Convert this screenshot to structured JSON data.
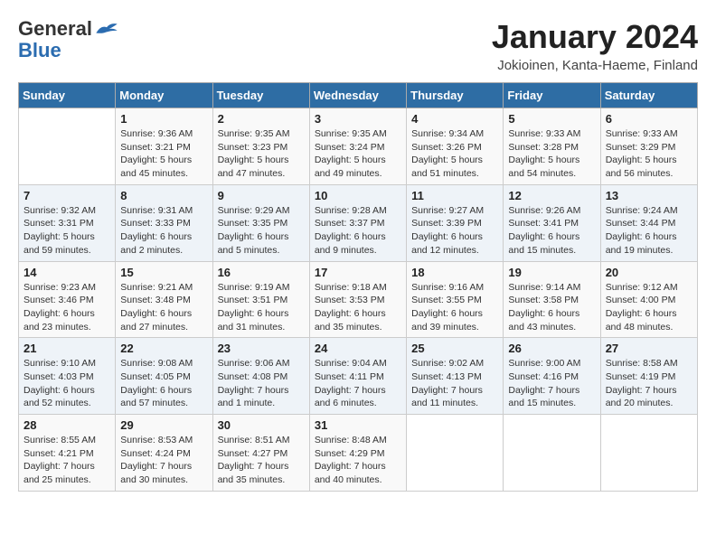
{
  "header": {
    "logo_general": "General",
    "logo_blue": "Blue",
    "month_title": "January 2024",
    "subtitle": "Jokioinen, Kanta-Haeme, Finland"
  },
  "days_of_week": [
    "Sunday",
    "Monday",
    "Tuesday",
    "Wednesday",
    "Thursday",
    "Friday",
    "Saturday"
  ],
  "weeks": [
    [
      {
        "day": "",
        "info": ""
      },
      {
        "day": "1",
        "info": "Sunrise: 9:36 AM\nSunset: 3:21 PM\nDaylight: 5 hours\nand 45 minutes."
      },
      {
        "day": "2",
        "info": "Sunrise: 9:35 AM\nSunset: 3:23 PM\nDaylight: 5 hours\nand 47 minutes."
      },
      {
        "day": "3",
        "info": "Sunrise: 9:35 AM\nSunset: 3:24 PM\nDaylight: 5 hours\nand 49 minutes."
      },
      {
        "day": "4",
        "info": "Sunrise: 9:34 AM\nSunset: 3:26 PM\nDaylight: 5 hours\nand 51 minutes."
      },
      {
        "day": "5",
        "info": "Sunrise: 9:33 AM\nSunset: 3:28 PM\nDaylight: 5 hours\nand 54 minutes."
      },
      {
        "day": "6",
        "info": "Sunrise: 9:33 AM\nSunset: 3:29 PM\nDaylight: 5 hours\nand 56 minutes."
      }
    ],
    [
      {
        "day": "7",
        "info": "Sunrise: 9:32 AM\nSunset: 3:31 PM\nDaylight: 5 hours\nand 59 minutes."
      },
      {
        "day": "8",
        "info": "Sunrise: 9:31 AM\nSunset: 3:33 PM\nDaylight: 6 hours\nand 2 minutes."
      },
      {
        "day": "9",
        "info": "Sunrise: 9:29 AM\nSunset: 3:35 PM\nDaylight: 6 hours\nand 5 minutes."
      },
      {
        "day": "10",
        "info": "Sunrise: 9:28 AM\nSunset: 3:37 PM\nDaylight: 6 hours\nand 9 minutes."
      },
      {
        "day": "11",
        "info": "Sunrise: 9:27 AM\nSunset: 3:39 PM\nDaylight: 6 hours\nand 12 minutes."
      },
      {
        "day": "12",
        "info": "Sunrise: 9:26 AM\nSunset: 3:41 PM\nDaylight: 6 hours\nand 15 minutes."
      },
      {
        "day": "13",
        "info": "Sunrise: 9:24 AM\nSunset: 3:44 PM\nDaylight: 6 hours\nand 19 minutes."
      }
    ],
    [
      {
        "day": "14",
        "info": "Sunrise: 9:23 AM\nSunset: 3:46 PM\nDaylight: 6 hours\nand 23 minutes."
      },
      {
        "day": "15",
        "info": "Sunrise: 9:21 AM\nSunset: 3:48 PM\nDaylight: 6 hours\nand 27 minutes."
      },
      {
        "day": "16",
        "info": "Sunrise: 9:19 AM\nSunset: 3:51 PM\nDaylight: 6 hours\nand 31 minutes."
      },
      {
        "day": "17",
        "info": "Sunrise: 9:18 AM\nSunset: 3:53 PM\nDaylight: 6 hours\nand 35 minutes."
      },
      {
        "day": "18",
        "info": "Sunrise: 9:16 AM\nSunset: 3:55 PM\nDaylight: 6 hours\nand 39 minutes."
      },
      {
        "day": "19",
        "info": "Sunrise: 9:14 AM\nSunset: 3:58 PM\nDaylight: 6 hours\nand 43 minutes."
      },
      {
        "day": "20",
        "info": "Sunrise: 9:12 AM\nSunset: 4:00 PM\nDaylight: 6 hours\nand 48 minutes."
      }
    ],
    [
      {
        "day": "21",
        "info": "Sunrise: 9:10 AM\nSunset: 4:03 PM\nDaylight: 6 hours\nand 52 minutes."
      },
      {
        "day": "22",
        "info": "Sunrise: 9:08 AM\nSunset: 4:05 PM\nDaylight: 6 hours\nand 57 minutes."
      },
      {
        "day": "23",
        "info": "Sunrise: 9:06 AM\nSunset: 4:08 PM\nDaylight: 7 hours\nand 1 minute."
      },
      {
        "day": "24",
        "info": "Sunrise: 9:04 AM\nSunset: 4:11 PM\nDaylight: 7 hours\nand 6 minutes."
      },
      {
        "day": "25",
        "info": "Sunrise: 9:02 AM\nSunset: 4:13 PM\nDaylight: 7 hours\nand 11 minutes."
      },
      {
        "day": "26",
        "info": "Sunrise: 9:00 AM\nSunset: 4:16 PM\nDaylight: 7 hours\nand 15 minutes."
      },
      {
        "day": "27",
        "info": "Sunrise: 8:58 AM\nSunset: 4:19 PM\nDaylight: 7 hours\nand 20 minutes."
      }
    ],
    [
      {
        "day": "28",
        "info": "Sunrise: 8:55 AM\nSunset: 4:21 PM\nDaylight: 7 hours\nand 25 minutes."
      },
      {
        "day": "29",
        "info": "Sunrise: 8:53 AM\nSunset: 4:24 PM\nDaylight: 7 hours\nand 30 minutes."
      },
      {
        "day": "30",
        "info": "Sunrise: 8:51 AM\nSunset: 4:27 PM\nDaylight: 7 hours\nand 35 minutes."
      },
      {
        "day": "31",
        "info": "Sunrise: 8:48 AM\nSunset: 4:29 PM\nDaylight: 7 hours\nand 40 minutes."
      },
      {
        "day": "",
        "info": ""
      },
      {
        "day": "",
        "info": ""
      },
      {
        "day": "",
        "info": ""
      }
    ]
  ]
}
